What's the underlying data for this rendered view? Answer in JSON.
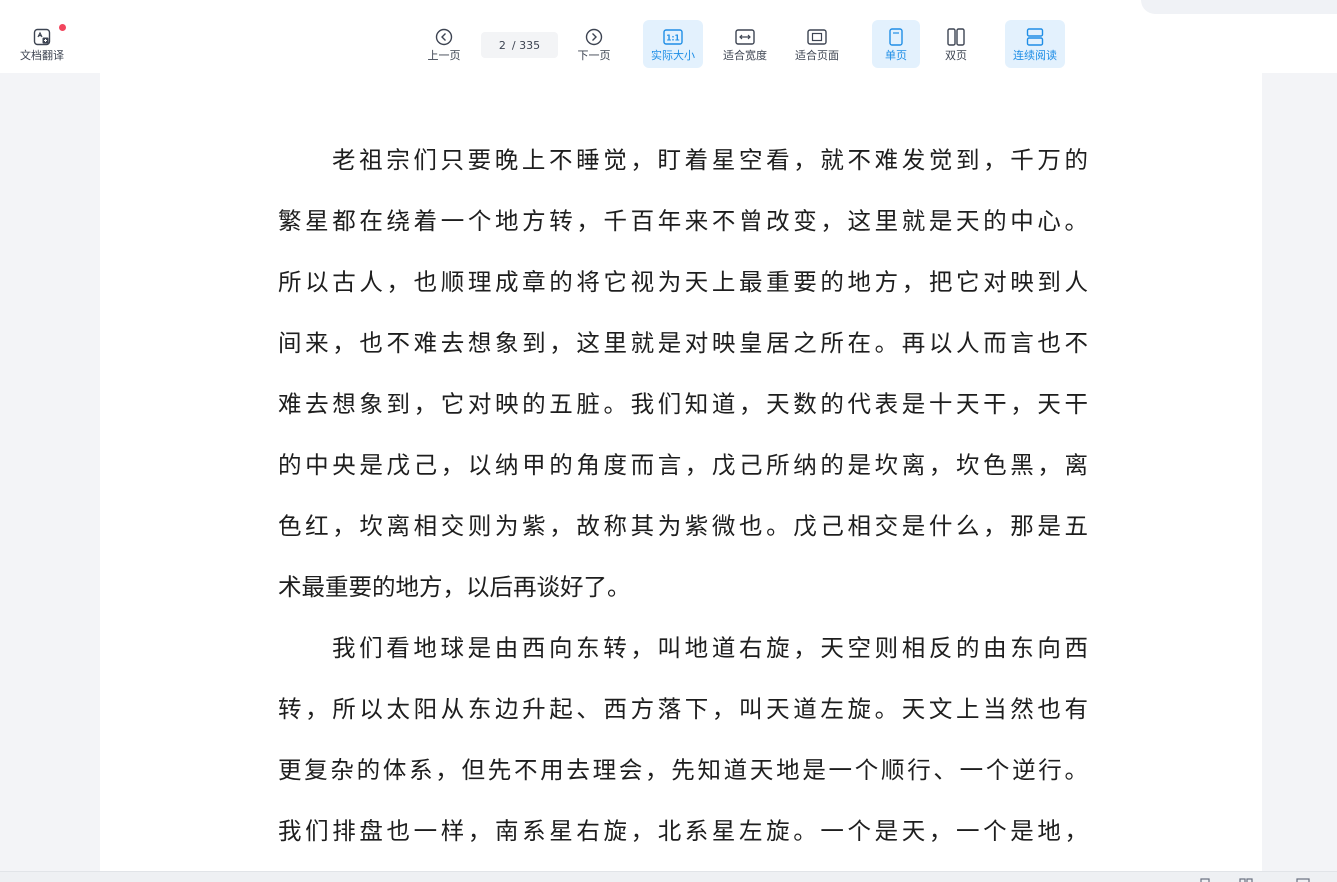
{
  "toolbar": {
    "translate_label": "文档翻译",
    "prev_label": "上一页",
    "next_label": "下一页",
    "current_page": "2",
    "total_pages": "/ 335",
    "actual_size_label": "实际大小",
    "fit_width_label": "适合宽度",
    "fit_page_label": "适合页面",
    "single_page_label": "单页",
    "double_page_label": "双页",
    "continuous_label": "连续阅读",
    "actual_size_icon_text": "1:1"
  },
  "document": {
    "paragraphs": [
      {
        "lines": [
          "老祖宗们只要晚上不睡觉，盯着星空看，就不难发觉到，千万的",
          "繁星都在绕着一个地方转，千百年来不曾改变，这里就是天的中心。",
          "所以古人，也顺理成章的将它视为天上最重要的地方，把它对映到人",
          "间来，也不难去想象到，这里就是对映皇居之所在。再以人而言也不",
          "难去想象到，它对映的五脏。我们知道，天数的代表是十天干，天干",
          "的中央是戊己，以纳甲的角度而言，戊己所纳的是坎离，坎色黑，离",
          "色红，坎离相交则为紫，故称其为紫微也。戊己相交是什么，那是五",
          "术最重要的地方，以后再谈好了。"
        ]
      },
      {
        "lines": [
          "我们看地球是由西向东转，叫地道右旋，天空则相反的由东向西",
          "转，所以太阳从东边升起、西方落下，叫天道左旋。天文上当然也有",
          "更复杂的体系，但先不用去理会，先知道天地是一个顺行、一个逆行。",
          "我们排盘也一样，南系星右旋，北系星左旋。一个是天，一个是地，"
        ]
      }
    ]
  },
  "colors": {
    "accent": "#1f8ee6",
    "active_bg": "#e3f1fd",
    "notification_dot": "#f2455d"
  }
}
